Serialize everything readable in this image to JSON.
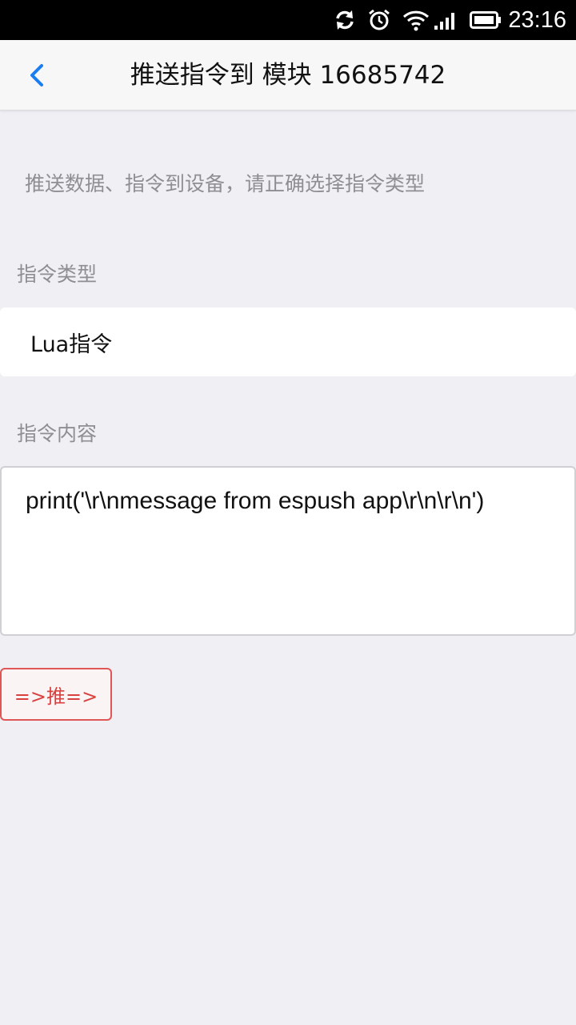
{
  "status_bar": {
    "time": "23:16",
    "icons": [
      "sync-icon",
      "alarm-icon",
      "wifi-icon",
      "signal-icon",
      "battery-icon"
    ]
  },
  "nav": {
    "title": "推送指令到 模块 16685742",
    "back_icon": "chevron-left-icon"
  },
  "hint": "推送数据、指令到设备，请正确选择指令类型",
  "command_type": {
    "label": "指令类型",
    "value": "Lua指令"
  },
  "command_content": {
    "label": "指令内容",
    "value": "print('\\r\\nmessage from espush app\\r\\n\\r\\n')"
  },
  "push_button": {
    "label": "=>推=>"
  },
  "colors": {
    "accent": "#1a7ef0",
    "button": "#d9413f",
    "background": "#efeff4"
  }
}
